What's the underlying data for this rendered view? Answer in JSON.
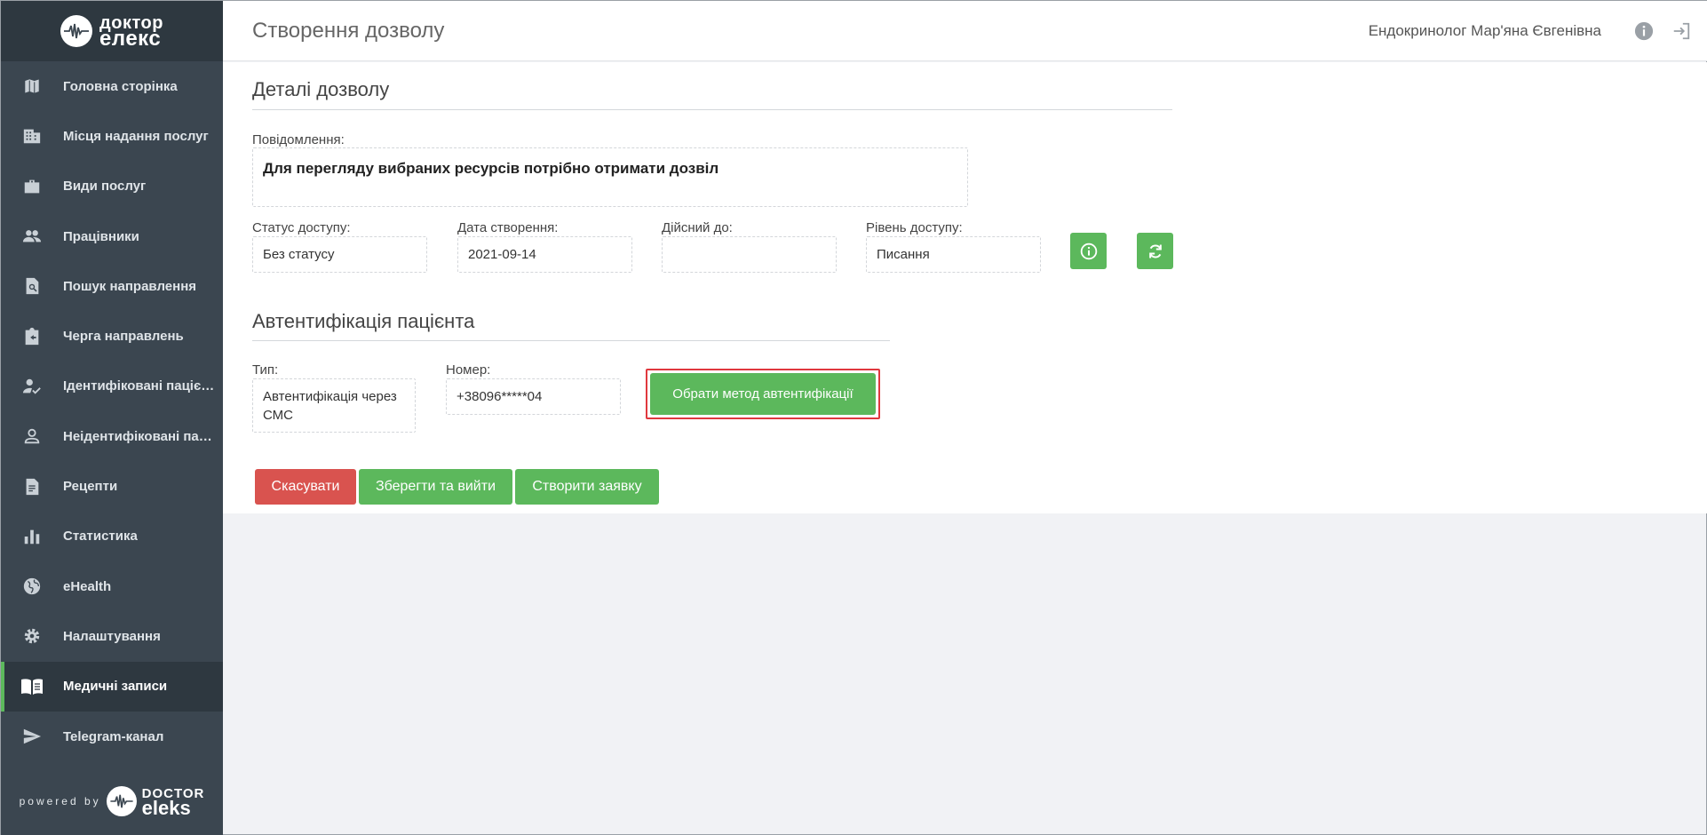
{
  "brand": {
    "line1": "доктор",
    "line2": "елекс",
    "powered_by": "powered by",
    "footer_line1": "DOCTOR",
    "footer_line2": "eleks"
  },
  "sidebar": {
    "items": [
      {
        "label": "Головна сторінка",
        "icon": "map-icon"
      },
      {
        "label": "Місця надання послуг",
        "icon": "building-icon"
      },
      {
        "label": "Види послуг",
        "icon": "briefcase-icon"
      },
      {
        "label": "Працівники",
        "icon": "people-icon"
      },
      {
        "label": "Пошук направлення",
        "icon": "document-search-icon"
      },
      {
        "label": "Черга направлень",
        "icon": "clipboard-return-icon"
      },
      {
        "label": "Ідентифіковані пацієнти",
        "icon": "person-check-icon"
      },
      {
        "label": "Неідентифіковані пацієнти",
        "icon": "person-outline-icon"
      },
      {
        "label": "Рецепти",
        "icon": "prescription-icon"
      },
      {
        "label": "Статистика",
        "icon": "bar-chart-icon"
      },
      {
        "label": "eHealth",
        "icon": "globe-icon"
      },
      {
        "label": "Налаштування",
        "icon": "gear-icon"
      },
      {
        "label": "Медичні записи",
        "icon": "open-book-icon",
        "active": true
      },
      {
        "label": "Telegram-канал",
        "icon": "send-icon"
      }
    ]
  },
  "header": {
    "title": "Створення дозволу",
    "user": "Ендокринолог Мар'яна Євгенівна"
  },
  "details": {
    "title": "Деталі дозволу",
    "message_label": "Повідомлення:",
    "message": "Для перегляду вибраних ресурсів потрібно отримати дозвіл",
    "status_label": "Статус доступу:",
    "status": "Без статусу",
    "created_label": "Дата створення:",
    "created": "2021-09-14",
    "valid_label": "Дійсний до:",
    "valid": "",
    "level_label": "Рівень доступу:",
    "level": "Писання"
  },
  "auth": {
    "title": "Автентифікація пацієнта",
    "type_label": "Тип:",
    "type": "Автентифікація через СМС",
    "number_label": "Номер:",
    "number": "+38096*****04",
    "choose_method": "Обрати метод автентифікації"
  },
  "actions": {
    "cancel": "Скасувати",
    "save_exit": "Зберегти та вийти",
    "create_request": "Створити заявку"
  },
  "colors": {
    "sidebar": "#3b4650",
    "accent_green": "#5cb85c",
    "danger": "#d9534f",
    "highlight": "#e0383e"
  }
}
